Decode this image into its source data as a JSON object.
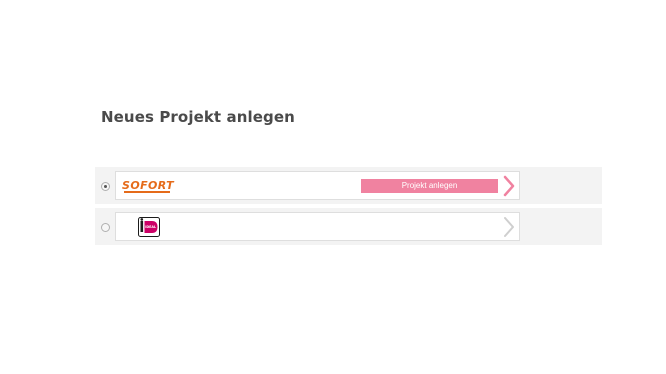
{
  "page": {
    "title": "Neues Projekt anlegen"
  },
  "providers": [
    {
      "logo_text": "SOFORT",
      "logo_icon": "sofort-logo",
      "selected": true,
      "button_label": "Projekt anlegen",
      "chevron_color": "#f082a0"
    },
    {
      "logo_text": "iDEAL",
      "logo_icon": "ideal-logo",
      "selected": false,
      "chevron_color": "#cfcfcf"
    }
  ],
  "colors": {
    "accent": "#f082a0",
    "ideal_pink": "#cc0066",
    "sofort_orange": "#e56b1a"
  }
}
